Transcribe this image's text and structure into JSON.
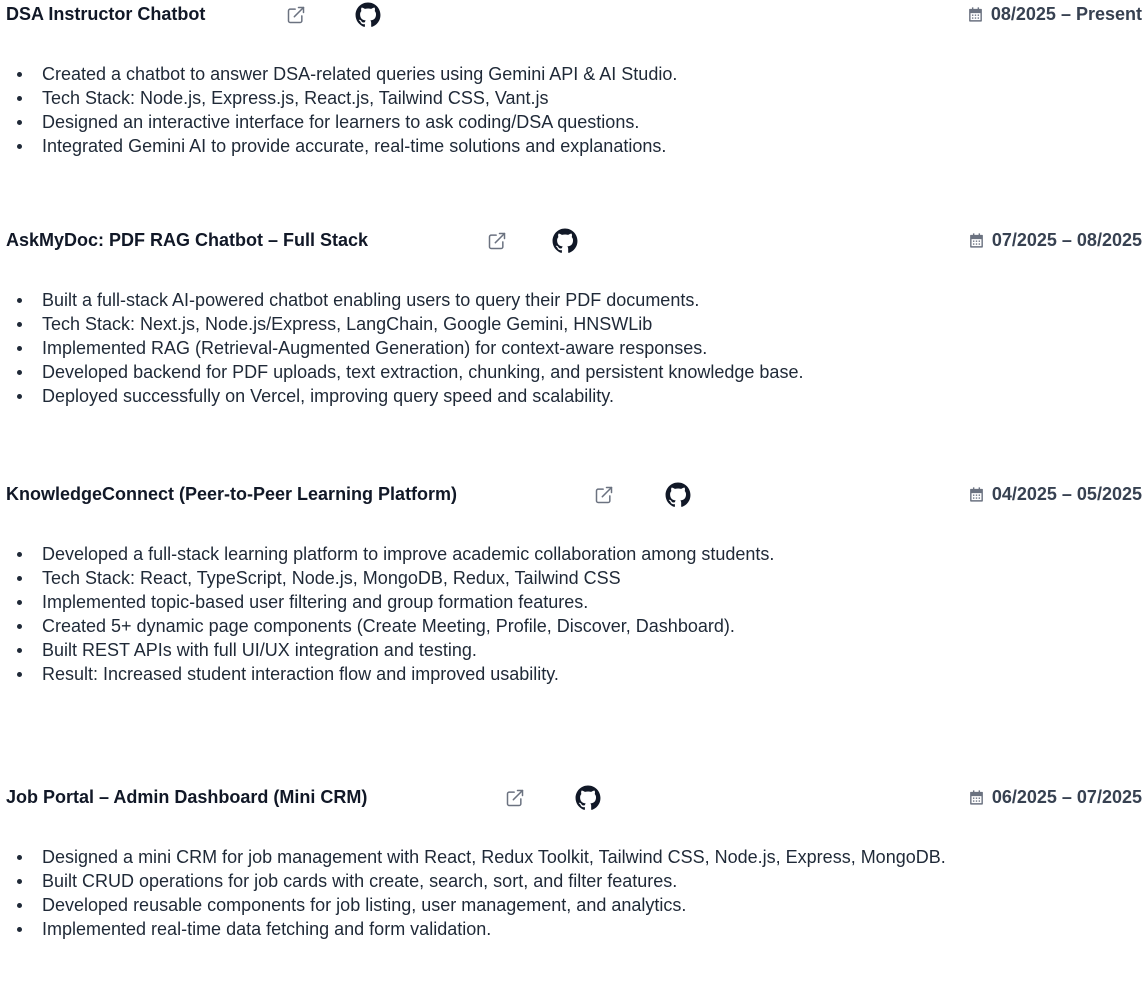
{
  "projects": [
    {
      "title": "DSA Instructor Chatbot",
      "date": "08/2025 – Present",
      "bullets": [
        "Created a chatbot to answer DSA-related queries using Gemini API & AI Studio.",
        "Tech Stack: Node.js, Express.js, React.js, Tailwind CSS, Vant.js",
        "Designed an interactive interface for learners to ask coding/DSA questions.",
        "Integrated Gemini AI to provide accurate, real-time solutions and explanations."
      ]
    },
    {
      "title": "AskMyDoc: PDF RAG Chatbot – Full Stack",
      "date": "07/2025 – 08/2025",
      "bullets": [
        "Built a full-stack AI-powered chatbot enabling users to query their PDF documents.",
        "Tech Stack: Next.js, Node.js/Express, LangChain, Google Gemini, HNSWLib",
        "Implemented RAG (Retrieval-Augmented Generation) for context-aware responses.",
        "Developed backend for PDF uploads, text extraction, chunking, and persistent knowledge base.",
        "Deployed successfully on Vercel, improving query speed and scalability."
      ]
    },
    {
      "title": "KnowledgeConnect (Peer-to-Peer Learning Platform)",
      "date": "04/2025 – 05/2025",
      "bullets": [
        "Developed a full-stack learning platform to improve academic collaboration among students.",
        "Tech Stack: React, TypeScript, Node.js, MongoDB, Redux, Tailwind CSS",
        "Implemented topic-based user filtering and group formation features.",
        "Created 5+ dynamic page components (Create Meeting, Profile, Discover, Dashboard).",
        "Built REST APIs with full UI/UX integration and testing.",
        "Result: Increased student interaction flow and improved usability."
      ]
    },
    {
      "title": "Job Portal – Admin Dashboard (Mini CRM)",
      "date": "06/2025 – 07/2025",
      "bullets": [
        "Designed a mini CRM for job management with React, Redux Toolkit, Tailwind CSS, Node.js, Express, MongoDB.",
        "Built CRUD operations for job cards with create, search, sort, and filter features.",
        "Developed reusable components for job listing, user management, and analytics.",
        "Implemented real-time data fetching and form validation."
      ]
    }
  ]
}
